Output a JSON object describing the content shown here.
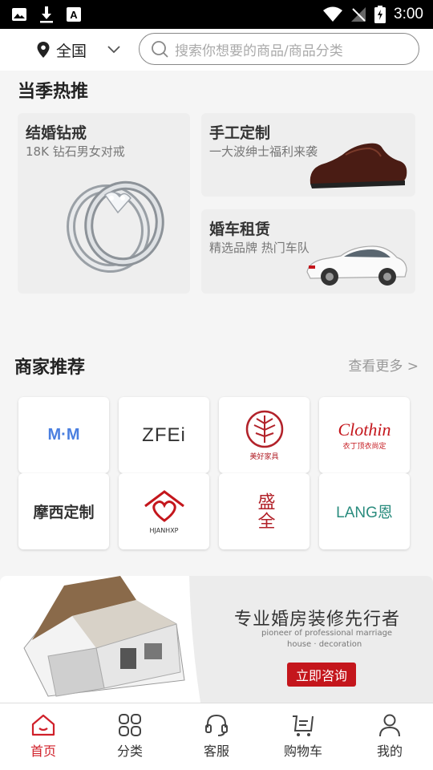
{
  "status_bar": {
    "time": "3:00"
  },
  "header": {
    "location": "全国",
    "search_placeholder": "搜索你想要的商品/商品分类"
  },
  "season": {
    "title": "当季热推",
    "cards": [
      {
        "title": "结婚钻戒",
        "subtitle": "18K 钻石男女对戒"
      },
      {
        "title": "手工定制",
        "subtitle": "一大波绅士福利来袭"
      },
      {
        "title": "婚车租赁",
        "subtitle": "精选品牌 热门车队"
      }
    ]
  },
  "merchants": {
    "title": "商家推荐",
    "more": "查看更多 >",
    "brands": [
      {
        "text": "M·M",
        "color": "#4a7fe0"
      },
      {
        "text": "ZFEi",
        "color": "#333333"
      },
      {
        "text": "美好家具",
        "color": "#b2222a"
      },
      {
        "text": "Clothin",
        "sub": "衣丁顶衣尚定",
        "color": "#c4161c"
      },
      {
        "text": "摩西定制",
        "color": "#333333"
      },
      {
        "text": "HJANHXP",
        "color": "#c4161c"
      },
      {
        "text": "盛全",
        "color": "#b2222a"
      },
      {
        "text": "LANG恩",
        "color": "#2a8c7e"
      }
    ]
  },
  "banner": {
    "headline": "专业婚房装修先行者",
    "sub1": "pioneer of professional marriage",
    "sub2": "house · decoration",
    "button": "立即咨询"
  },
  "tabs": [
    {
      "label": "首页",
      "icon": "home-icon"
    },
    {
      "label": "分类",
      "icon": "category-icon"
    },
    {
      "label": "客服",
      "icon": "headset-icon"
    },
    {
      "label": "购物车",
      "icon": "cart-icon"
    },
    {
      "label": "我的",
      "icon": "user-icon"
    }
  ],
  "colors": {
    "accent": "#d0202a"
  }
}
